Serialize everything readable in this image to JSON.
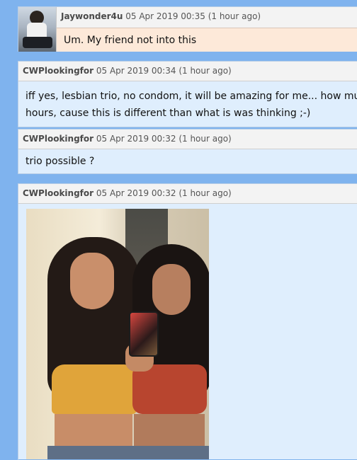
{
  "messages": [
    {
      "author": "Jaywonder4u",
      "date": "05 Apr 2019 00:35",
      "ago": "(1 hour ago)",
      "text": "Um. My friend not into this"
    },
    {
      "author": "CWPlookingfor",
      "date": "05 Apr 2019 00:34",
      "ago": "(1 hour ago)",
      "text_line1": "iff yes, lesbian trio, no condom, it will be amazing for me... how muc",
      "text_line2": "hours, cause this is different than what is was thinking ;-)"
    },
    {
      "author": "CWPlookingfor",
      "date": "05 Apr 2019 00:32",
      "ago": "(1 hour ago)",
      "text": "trio possible ?"
    },
    {
      "author": "CWPlookingfor",
      "date": "05 Apr 2019 00:32",
      "ago": "(1 hour ago)"
    }
  ],
  "colors": {
    "page_background": "#7fb3ee",
    "header_background": "#f3f3f3",
    "message_background": "#dfeefd",
    "highlighted_message_background": "#fde9d9"
  }
}
